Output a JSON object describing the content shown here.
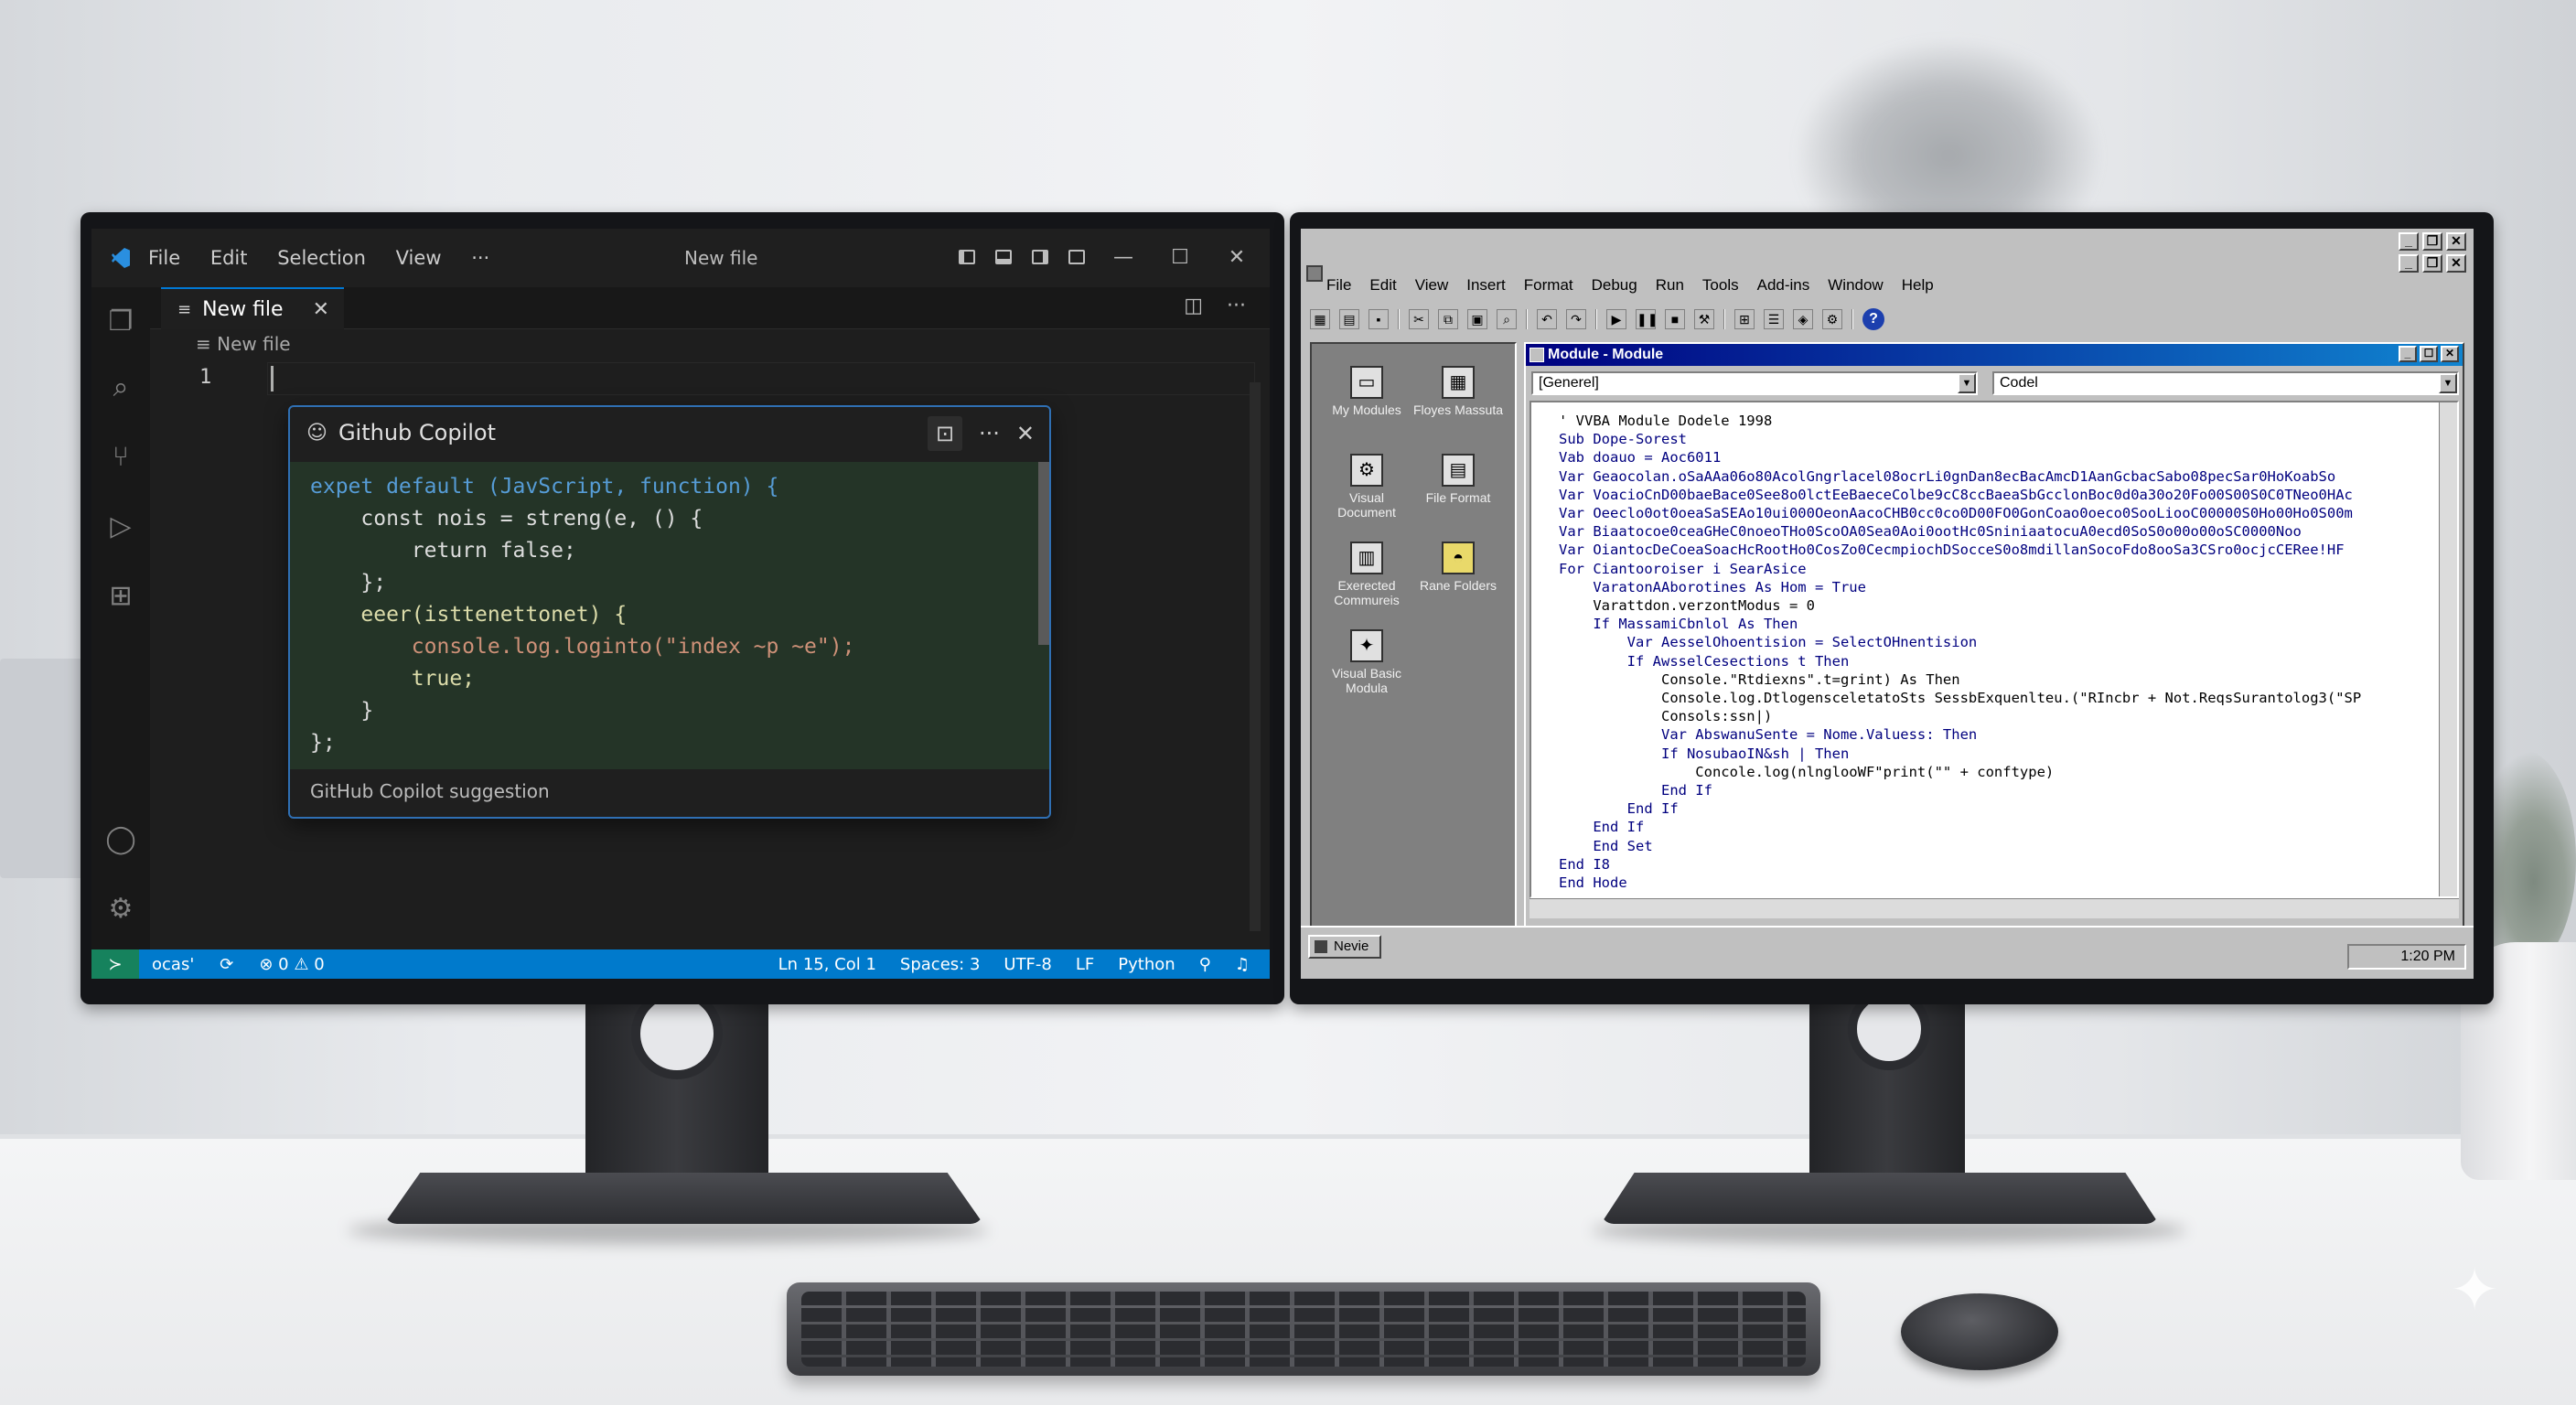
{
  "vscode": {
    "menu": [
      "File",
      "Edit",
      "Selection",
      "View",
      "···"
    ],
    "window_title": "New file",
    "tab": {
      "label": "New file",
      "close": "✕"
    },
    "breadcrumb": "New file",
    "line_number": "1",
    "copilot": {
      "title": "Github Copilot",
      "code_lines": [
        "expet default (JavScript, function) {",
        "    const nois = streng(e, () {",
        "        return false;",
        "    };",
        "    eeer(isttenettonet) {",
        "        console.log.loginto(\"index ~p ~e\");",
        "        true;",
        "    }",
        "};"
      ],
      "footer": "GitHub Copilot suggestion"
    },
    "status": {
      "branch": "οcas'",
      "problems": "⊗ 0 ⚠ 0",
      "position": "Ln 15, Col 1",
      "spaces": "Spaces: 3",
      "encoding": "UTF-8",
      "eol": "LF",
      "language": "Python"
    },
    "colors": {
      "statusbar": "#007acc",
      "background": "#1e1e1e",
      "remote": "#16825d"
    }
  },
  "vba": {
    "menu": [
      "File",
      "Edit",
      "View",
      "Insert",
      "Format",
      "Debug",
      "Run",
      "Tools",
      "Add-ins",
      "Window",
      "Help"
    ],
    "module_title": "Module - Module",
    "object_combo": "[Generel]",
    "proc_combo": "Codel",
    "project_items": [
      {
        "label": "My Modules",
        "icon": "computer-icon"
      },
      {
        "label": "Floyes Massuta",
        "icon": "document-grid-icon"
      },
      {
        "label": "Visual Document",
        "icon": "gears-icon"
      },
      {
        "label": "File Format",
        "icon": "file-icon"
      },
      {
        "label": "Exerected Commureis",
        "icon": "calendar-icon"
      },
      {
        "label": "Rane Folders",
        "icon": "folder-icon"
      },
      {
        "label": "Visual Basic Modula",
        "icon": "star-icon"
      }
    ],
    "code_lines": [
      "' VVBA Module Dodele 1998",
      "Sub Dope-Sorest",
      "Vab doauo = Aoc6011",
      "Var Geaocolan.oSaAAa06o80AcolGngrlacel08ocrLi0gnDan8ecBacAmcD1AanGcbacSabo08pecSar0HoKoabSo",
      "Var VoacioCnD00baeBace0See8o0lctEeBaeceColbe9cC8ccBaeaSbGcclonBoc0d0a30o20Fo00S00S0C0TNeo0HAc",
      "Var Oeeclo0ot0oeaSaSEAo10ui000OeonAacoCHB0cc0co0D00FO0GonCoao0oeco0SooLiooC00000S0Ho00Ho0S00m",
      "Var Biaatocoe0ceaGHeC0noeoTHo0ScoOA0Sea0Aoi0ootHc0SniniaatocuA0ecd0SoS0o00o00oSC0000Noo",
      "Var OiantocDeCoeaSoacHcRootHo0CosZo0CecmpiochDSocceS0o8mdillanSocoFdo8ooSa3CSro0ocjcCERee!HF",
      "For Ciantooroiser i SearAsice",
      "    VaratonAAborotines As Hom = True",
      "    Varattdon.verzontModus = 0",
      "    If MassamiCbnlol As Then",
      "        Var AesselOhoentision = SelectOHnentision",
      "        If AwsselCesections t Then",
      "            Console.\"Rtdiexns\".t=grint) As Then",
      "            Console.log.DtlogensceletatoSts SessbExquenlteu.(\"RIncbr + Not.ReqsSurantolog3(\"SP",
      "            Consols:ssn|)",
      "            Var AbswanuSente = Nome.Valuess: Then",
      "            If NosubaoIN&sh | Then",
      "                Concole.log(nlnglooWF\"print(\"\" + conftype)",
      "            End If",
      "        End If",
      "    End If",
      "    End Set",
      "End I8",
      "End Hode"
    ],
    "taskbar_button": "Nevie",
    "clock": "1:20 PM",
    "colors": {
      "titlebar_start": "#000080",
      "titlebar_end": "#1084d0",
      "face": "#c0c0c0"
    }
  }
}
